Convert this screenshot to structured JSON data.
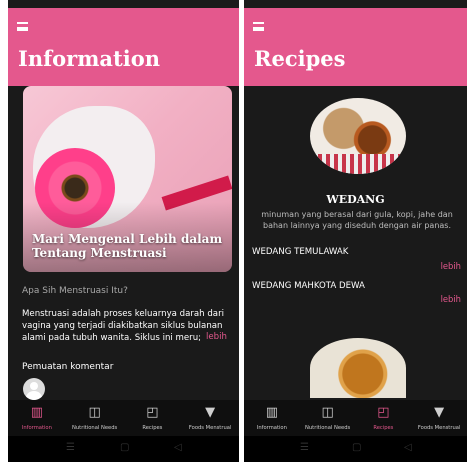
{
  "screens": {
    "information": {
      "title": "Information",
      "card_title": "Mari Mengenal Lebih dalam Tentang Menstruasi",
      "question": "Apa Sih Menstruasi Itu?",
      "body": "Menstruasi adalah proses keluarnya darah dari vagina yang terjadi diakibatkan siklus bulanan alami pada tubuh wanita. Siklus ini meru;",
      "more_label": "lebih",
      "comments_label": "Pemuatan komentar"
    },
    "recipes": {
      "title": "Recipes",
      "featured": {
        "name": "WEDANG",
        "description": "minuman yang berasal dari gula, kopi, jahe dan bahan lainnya yang diseduh dengan air panas."
      },
      "items": [
        {
          "name": "WEDANG TEMULAWAK",
          "more_label": "lebih"
        },
        {
          "name": "WEDANG MAHKOTA DEWA",
          "more_label": "lebih"
        }
      ]
    }
  },
  "nav": {
    "items": [
      {
        "label": "Information",
        "icon": "book-icon",
        "glyph": "▥"
      },
      {
        "label": "Nutritional Needs",
        "icon": "nutrition-icon",
        "glyph": "◫"
      },
      {
        "label": "Recipes",
        "icon": "recipe-icon",
        "glyph": "◰"
      },
      {
        "label": "Foods Menstrual",
        "icon": "mortar-pestle-icon",
        "glyph": "▼"
      }
    ],
    "active_left": "Information",
    "active_right": "Recipes"
  },
  "system_nav": {
    "menu": "☰",
    "home": "▢",
    "back": "◁"
  },
  "colors": {
    "accent": "#e4588d",
    "background": "#1a1a1a"
  }
}
